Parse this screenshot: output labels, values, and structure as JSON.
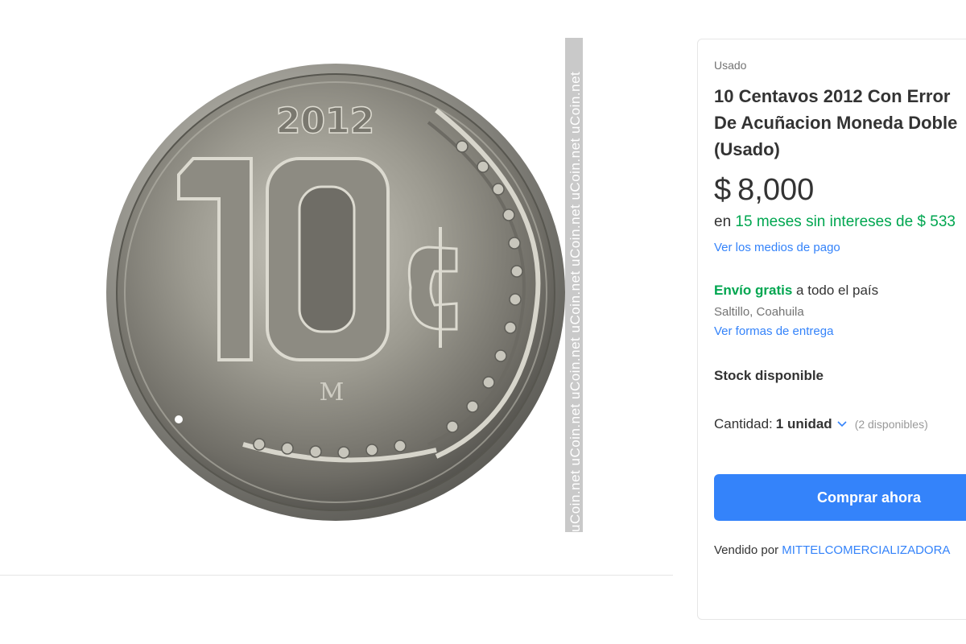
{
  "gallery": {
    "image_alt": "10 centavos 2012 coin",
    "coin_year": "2012",
    "coin_value": "10",
    "watermark": "uCoin.net uCoin.net uCoin.net uCoin.net uCoin.net uCoin.net uCoin.net"
  },
  "product": {
    "condition": "Usado",
    "title_lines": [
      "10 Centavos 2012 Con Error",
      "De Acuñacion Moneda Doble",
      "(Usado)"
    ],
    "price_symbol": "$",
    "price_value": "8,000",
    "installments_prefix": "en",
    "installments_highlight": "15 meses sin intereses de $ 533",
    "payment_link": "Ver los medios de pago",
    "shipping_free": "Envío gratis",
    "shipping_rest": "a todo el país",
    "location": "Saltillo, Coahuila",
    "delivery_link": "Ver formas de entrega",
    "stock": "Stock disponible",
    "quantity_label": "Cantidad:",
    "quantity_value": "1 unidad",
    "quantity_available": "(2 disponibles)",
    "buy_button": "Comprar ahora",
    "seller_prefix": "Vendido por",
    "seller_name": "MITTELCOMERCIALIZADORA"
  },
  "colors": {
    "accent_blue": "#3483fa",
    "success_green": "#00a650",
    "coin_silver": "#8f8d86"
  }
}
